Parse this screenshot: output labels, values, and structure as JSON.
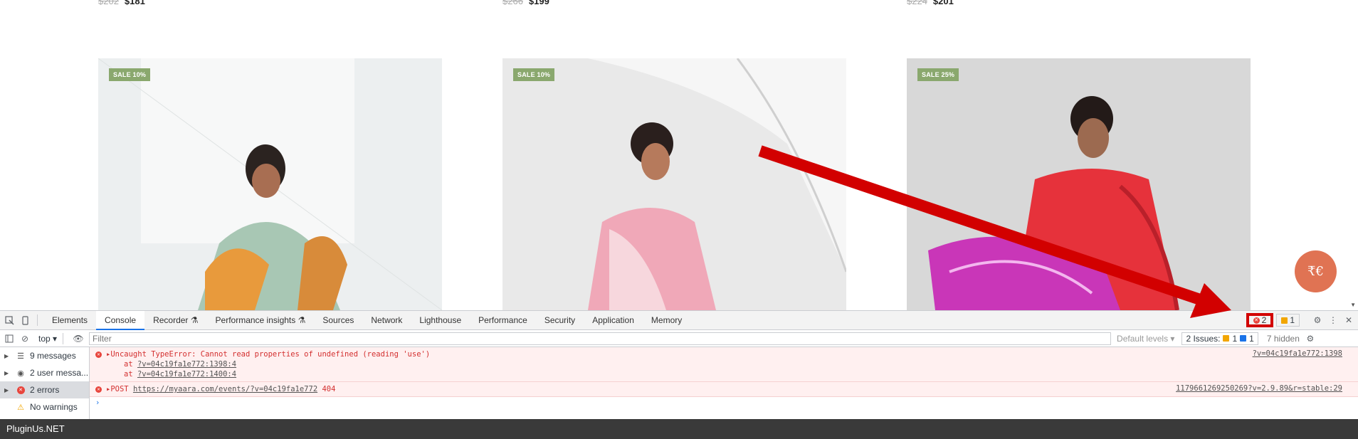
{
  "store": {
    "prices": [
      {
        "old": "$202",
        "new": "$181"
      },
      {
        "old": "$266",
        "new": "$199"
      },
      {
        "old": "$224",
        "new": "$201"
      }
    ],
    "products": [
      {
        "badge": "SALE 10%",
        "dress_color": "#a8c7b4",
        "accent": "#e89a3c",
        "bg": "#eceff0"
      },
      {
        "badge": "SALE 10%",
        "dress_color": "#f0a8b8",
        "accent": "#f7d7dd",
        "bg": "#e9e9e9"
      },
      {
        "badge": "SALE 25%",
        "dress_color": "#e6323b",
        "accent": "#c936b8",
        "bg": "#d8d8d8"
      }
    ],
    "chat_icon": "₹€"
  },
  "devtools": {
    "tabs": [
      "Elements",
      "Console",
      "Recorder",
      "Performance insights",
      "Sources",
      "Network",
      "Lighthouse",
      "Performance",
      "Security",
      "Application",
      "Memory"
    ],
    "error_count": "2",
    "issue_count": "1",
    "context": "top",
    "filter_placeholder": "Filter",
    "levels": "Default levels",
    "issues_label": "2 Issues:",
    "issues_warn": "1",
    "issues_info": "1",
    "hidden": "7 hidden",
    "sidebar": [
      {
        "label": "9 messages",
        "icon": "list-icon"
      },
      {
        "label": "2 user messa...",
        "icon": "user-icon"
      },
      {
        "label": "2 errors",
        "icon": "error-icon"
      },
      {
        "label": "No warnings",
        "icon": "warning-icon"
      }
    ],
    "messages": [
      {
        "text": "Uncaught TypeError: Cannot read properties of undefined (reading 'use')",
        "at1_prefix": "at ",
        "at1_link": "?v=04c19fa1e772:1398:4",
        "at2_prefix": "at ",
        "at2_link": "?v=04c19fa1e772:1400:4",
        "source": "?v=04c19fa1e772:1398"
      },
      {
        "method": "POST",
        "url": "https://myaara.com/events/?v=04c19fa1e772",
        "status": "404",
        "source": "1179661269250269?v=2.9.89&r=stable:29"
      }
    ]
  },
  "footer": {
    "text": "PluginUs.NET"
  },
  "colors": {
    "annotation": "#d20000",
    "accent": "#1a73e8",
    "error": "#d32f2f"
  }
}
